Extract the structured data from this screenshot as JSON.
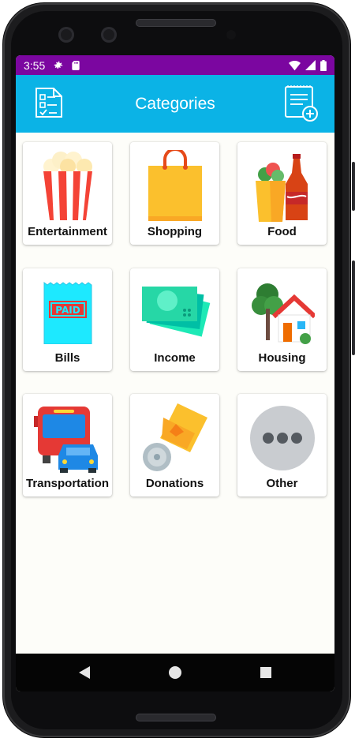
{
  "status_bar": {
    "time": "3:55",
    "icons": [
      "settings-icon",
      "sd-card-icon",
      "wifi-icon",
      "signal-icon",
      "battery-icon"
    ]
  },
  "app_bar": {
    "title": "Categories",
    "left_icon": "checklist-icon",
    "right_icon": "add-note-icon",
    "color": "#0bb3e6"
  },
  "categories": [
    {
      "label": "Entertainment",
      "icon": "popcorn-icon"
    },
    {
      "label": "Shopping",
      "icon": "shopping-bag-icon"
    },
    {
      "label": "Food",
      "icon": "food-icon"
    },
    {
      "label": "Bills",
      "icon": "paid-bill-icon"
    },
    {
      "label": "Income",
      "icon": "money-icon"
    },
    {
      "label": "Housing",
      "icon": "house-icon"
    },
    {
      "label": "Transportation",
      "icon": "bus-car-icon"
    },
    {
      "label": "Donations",
      "icon": "donation-tag-icon"
    },
    {
      "label": "Other",
      "icon": "more-dots-icon"
    }
  ],
  "nav_bar": {
    "buttons": [
      "back-icon",
      "home-icon",
      "recents-icon"
    ]
  },
  "colors": {
    "status_bar": "#7b06a0",
    "app_bar": "#0bb3e6",
    "background": "#fdfdf9"
  }
}
